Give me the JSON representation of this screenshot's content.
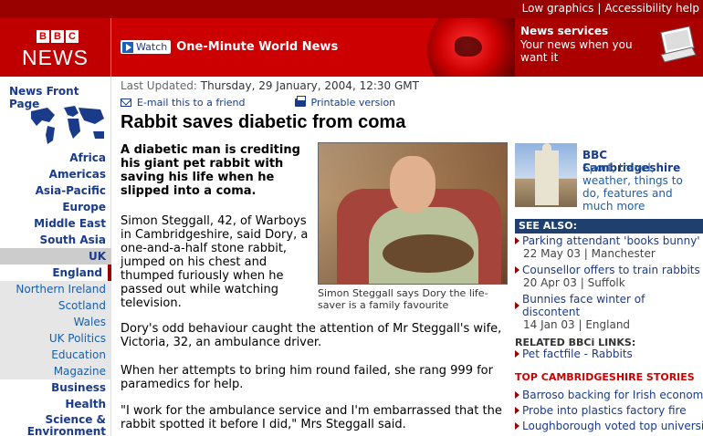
{
  "topbar": {
    "low_graphics": "Low graphics",
    "accessibility": "Accessibility help",
    "separator": "|"
  },
  "banner": {
    "bbc": [
      "B",
      "B",
      "C"
    ],
    "news": "NEWS",
    "watch_label": "Watch",
    "watch_title": "One-Minute World News",
    "services_title": "News services",
    "services_desc": "Your news when you want it"
  },
  "nav": {
    "front_page": "News Front Page",
    "regions": [
      "Africa",
      "Americas",
      "Asia-Pacific",
      "Europe",
      "Middle East",
      "South Asia"
    ],
    "uk": "UK",
    "england": "England",
    "sub": [
      "Northern Ireland",
      "Scotland",
      "Wales",
      "UK Politics",
      "Education",
      "Magazine"
    ],
    "more": [
      "Business",
      "Health"
    ],
    "science": "Science & Environment"
  },
  "article": {
    "updated_label": "Last Updated:",
    "updated_value": "Thursday, 29 January, 2004, 12:30 GMT",
    "email": "E-mail this to a friend",
    "print": "Printable version",
    "headline": "Rabbit saves diabetic from coma",
    "lead": "A diabetic man is crediting his giant pet rabbit with saving his life when he slipped into a coma.",
    "p1": "Simon Steggall, 42, of Warboys in Cambridgeshire, said Dory, a one-and-a-half stone rabbit, jumped on his chest and thumped furiously when he passed out while watching television.",
    "p2": "Dory's odd behaviour caught the attention of Mr Steggall's wife, Victoria, 32, an ambulance driver.",
    "p3": "When her attempts to bring him round failed, she rang 999 for paramedics for help.",
    "p4": "\"I work for the ambulance service and I'm embarrassed that the rabbit spotted it before I did,\" Mrs Steggall said.",
    "caption": "Simon Steggall says Dory the life-saver is a family favourite"
  },
  "sidebar": {
    "promo_title": "BBC Cambridgeshire",
    "promo_desc": "Sport, travel, weather, things to do, features and much more",
    "see_also_label": "SEE ALSO:",
    "see_also": [
      {
        "title": "Parking attendant 'books bunny'",
        "meta": "22 May 03  |  Manchester"
      },
      {
        "title": "Counsellor offers to train rabbits",
        "meta": "20 Apr 03  |  Suffolk"
      },
      {
        "title": "Bunnies face winter of discontent",
        "meta": "14 Jan 03  |  England"
      }
    ],
    "related_label": "RELATED BBCi LINKS:",
    "related_link": "Pet factfile - Rabbits",
    "top_stories_label": "TOP CAMBRIDGESHIRE STORIES",
    "top_stories": [
      "Barroso backing for Irish economy",
      "Probe into plastics factory fire",
      "Loughborough voted top university"
    ]
  }
}
